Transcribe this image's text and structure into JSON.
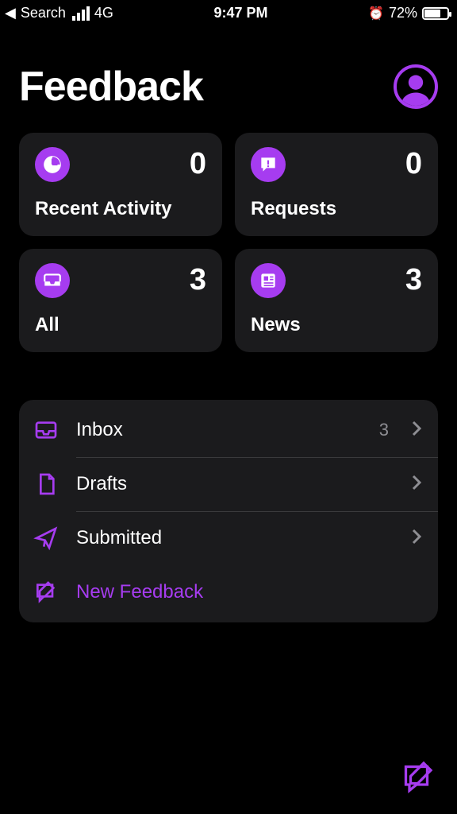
{
  "status_bar": {
    "back_label": "Search",
    "network_type": "4G",
    "time": "9:47 PM",
    "battery_pct": "72%",
    "battery_fill_pct": 72
  },
  "header": {
    "title": "Feedback"
  },
  "tiles": [
    {
      "icon": "clock",
      "count": "0",
      "label": "Recent Activity"
    },
    {
      "icon": "alert",
      "count": "0",
      "label": "Requests"
    },
    {
      "icon": "tray",
      "count": "3",
      "label": "All"
    },
    {
      "icon": "news",
      "count": "3",
      "label": "News"
    }
  ],
  "list": {
    "items": [
      {
        "icon": "inbox",
        "label": "Inbox",
        "count": "3",
        "chevron": true,
        "accent": false
      },
      {
        "icon": "document",
        "label": "Drafts",
        "count": "",
        "chevron": true,
        "accent": false
      },
      {
        "icon": "paperplane",
        "label": "Submitted",
        "count": "",
        "chevron": true,
        "accent": false
      },
      {
        "icon": "compose",
        "label": "New Feedback",
        "count": "",
        "chevron": false,
        "accent": true
      }
    ]
  }
}
